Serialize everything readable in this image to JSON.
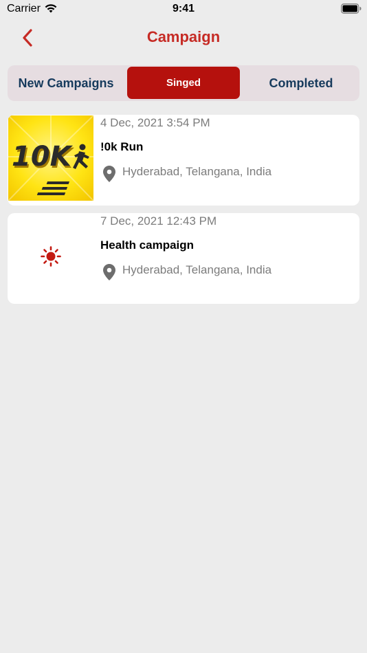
{
  "status_bar": {
    "carrier": "Carrier",
    "time": "9:41"
  },
  "header": {
    "title": "Campaign"
  },
  "segments": [
    {
      "label": "New Campaigns",
      "selected": false
    },
    {
      "label": "Singed",
      "selected": true
    },
    {
      "label": "Completed",
      "selected": false
    }
  ],
  "campaigns": [
    {
      "date": "4 Dec, 2021 3:54 PM",
      "title": "!0k Run",
      "location": "Hyderabad, Telangana, India",
      "thumbnail_icon": "10k-run-image",
      "thumbnail_text": "10K"
    },
    {
      "date": "7 Dec, 2021 12:43 PM",
      "title": "Health campaign",
      "location": "Hyderabad, Telangana, India",
      "thumbnail_icon": "sun-icon"
    }
  ],
  "colors": {
    "accent": "#c62b25",
    "segment_selected_bg": "#b5110d",
    "segment_text": "#163a5c",
    "segment_bg": "#e6dde1",
    "background": "#ececec",
    "muted_text": "#7c7c7c"
  }
}
